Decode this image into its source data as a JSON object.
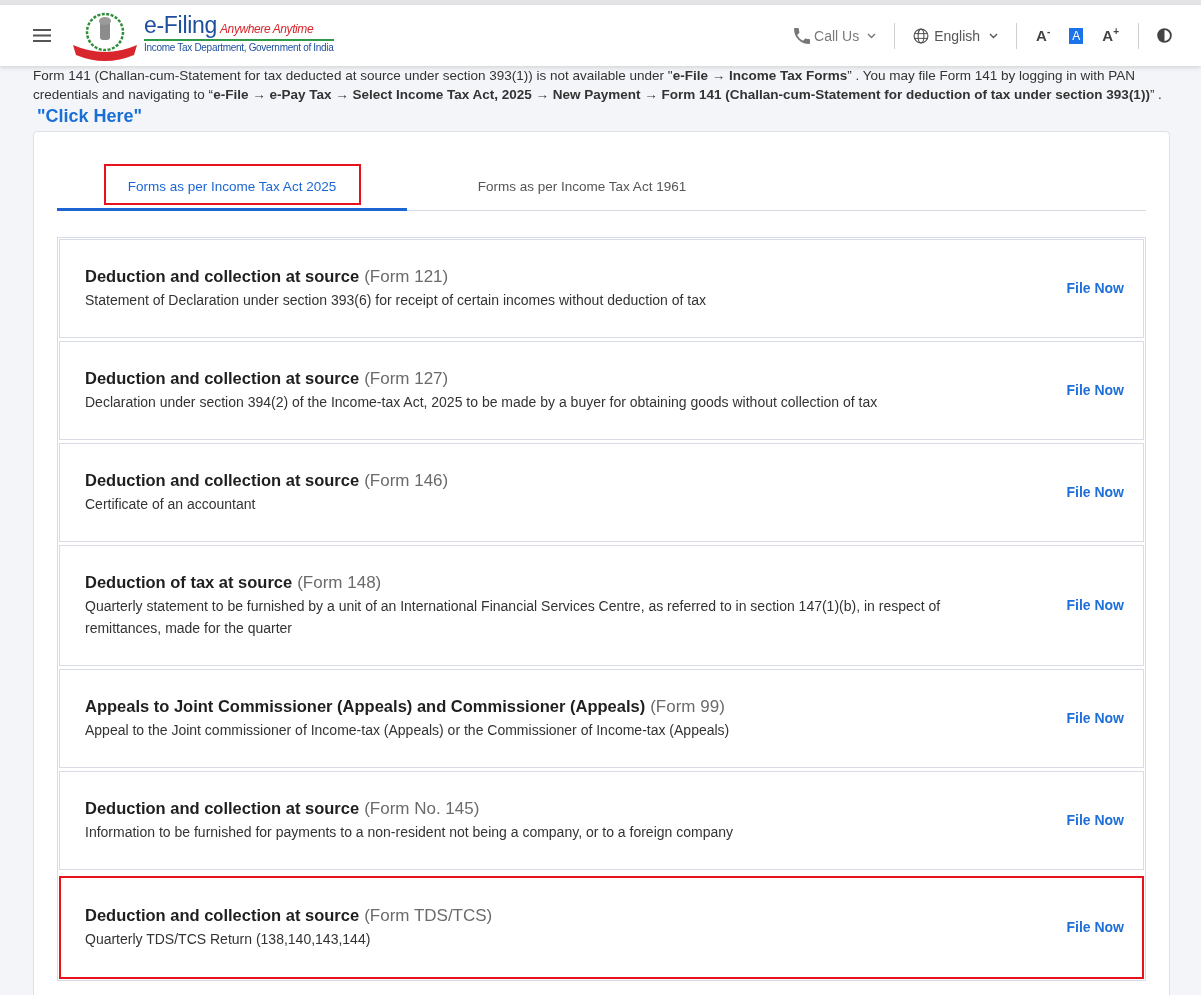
{
  "header": {
    "logo": {
      "title": "e-Filing",
      "tagline": "Anywhere Anytime",
      "subtitle": "Income Tax Department, Government of India"
    },
    "call_us": "Call Us",
    "language": "English",
    "font_size_buttons": [
      {
        "label": "A$^{-}$",
        "selected": false
      },
      {
        "label": "A",
        "selected": true
      },
      {
        "label": "A$^{+}$",
        "selected": false
      }
    ]
  },
  "notice": {
    "text": "Form 141 (Challan-cum-Statement for tax deducted at source under section 393(1)) is not available under \"**e-File → Income Tax Forms**” . You may file Form 141 by logging in with PAN credentials and navigating to “**e-File → e-Pay Tax → Select Income Tax Act, 2025 → New Payment → Form 141 (Challan-cum-Statement for deduction of tax under section 393(1))**” .",
    "link": "\"Click Here\""
  },
  "tabs": [
    {
      "label": "Forms as per Income Tax Act 2025",
      "selected": true,
      "highlighted": true
    },
    {
      "label": "Forms as per Income Tax Act 1961",
      "selected": false,
      "highlighted": false
    }
  ],
  "forms": [
    {
      "title": "Deduction and collection at source",
      "form": "(Form 121)",
      "description": "Statement of Declaration under section 393(6) for receipt of certain incomes without deduction of tax",
      "action": "File Now",
      "highlighted": false
    },
    {
      "title": "Deduction and collection at source",
      "form": "(Form 127)",
      "description": "Declaration under section 394(2) of the Income-tax Act, 2025 to be made by a buyer for obtaining goods without collection of tax",
      "action": "File Now",
      "highlighted": false
    },
    {
      "title": "Deduction and collection at source",
      "form": "(Form 146)",
      "description": "Certificate of an accountant",
      "action": "File Now",
      "highlighted": false
    },
    {
      "title": "Deduction of tax at source",
      "form": "(Form 148)",
      "description": "Quarterly statement to be furnished by a unit of an International Financial Services Centre, as referred to in section 147(1)(b), in respect of remittances, made for the quarter",
      "action": "File Now",
      "highlighted": false
    },
    {
      "title": "Appeals to Joint Commissioner (Appeals) and Commissioner (Appeals)",
      "form": "(Form 99)",
      "description": "Appeal to the Joint commissioner of Income-tax (Appeals) or the Commissioner of Income-tax (Appeals)",
      "action": "File Now",
      "highlighted": false
    },
    {
      "title": "Deduction and collection at source",
      "form": "(Form No. 145)",
      "description": "Information to be furnished for payments to a non-resident not being a company, or to a foreign company",
      "action": "File Now",
      "highlighted": false
    },
    {
      "title": "Deduction and collection at source",
      "form": "(Form TDS/TCS)",
      "description": "Quarterly TDS/TCS Return (138,140,143,144)",
      "action": "File Now",
      "highlighted": true
    }
  ]
}
